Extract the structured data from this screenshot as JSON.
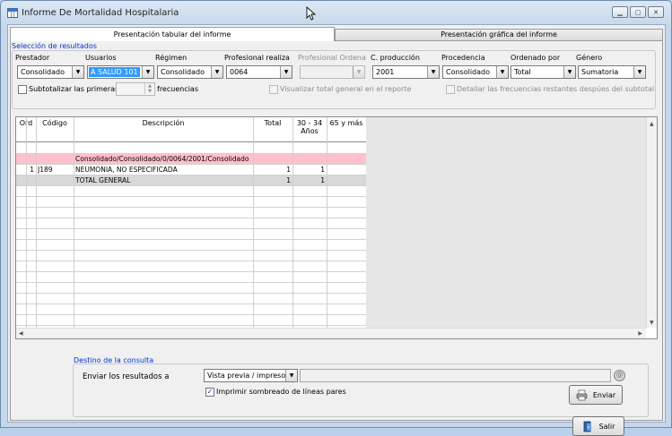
{
  "window": {
    "title": "Informe De Mortalidad Hospitalaria"
  },
  "tabs": [
    {
      "label": "Presentación tabular del informe",
      "active": true
    },
    {
      "label": "Presentación gráfica del informe",
      "active": false
    }
  ],
  "filters": {
    "section_title": "Selección de resultados",
    "fields": [
      {
        "label": "Prestador",
        "value": "Consolidado",
        "enabled": true
      },
      {
        "label": "Usuarios",
        "value": "A SALUD 101",
        "enabled": true
      },
      {
        "label": "Régimen",
        "value": "Consolidado",
        "enabled": true
      },
      {
        "label": "Profesional realiza",
        "value": "0064",
        "enabled": true
      },
      {
        "label": "Profesional Ordena",
        "value": "",
        "enabled": false
      },
      {
        "label": "C. producción",
        "value": "2001",
        "enabled": true
      },
      {
        "label": "Procedencia",
        "value": "Consolidado",
        "enabled": true
      },
      {
        "label": "Ordenado por",
        "value": "Total",
        "enabled": true
      },
      {
        "label": "Género",
        "value": "Sumatoria",
        "enabled": true
      }
    ],
    "subtotal_label": "Subtotalizar las primeras",
    "subtotal_suffix": "frecuencias",
    "visualizar_label": "Visualizar total general en el reporte",
    "detallar_label": "Detallar las frecuencias restantes despúes del subtotal"
  },
  "table": {
    "columns": [
      "Ord",
      "Código",
      "Descripción",
      "Total",
      "30 - 34 Años",
      "65 y más"
    ],
    "rows": [
      {
        "ord": "",
        "codigo": "",
        "descripcion": "",
        "total": "",
        "c30": "",
        "c65": "",
        "style": "blank"
      },
      {
        "ord": "",
        "codigo": "",
        "descripcion": "Consolidado/Consolidado/0/0064/2001/Consolidado",
        "total": "",
        "c30": "",
        "c65": "",
        "style": "pink"
      },
      {
        "ord": "1",
        "codigo": "J189",
        "descripcion": "NEUMONIA, NO ESPECIFICADA",
        "total": "1",
        "c30": "1",
        "c65": "",
        "style": "normal"
      },
      {
        "ord": "",
        "codigo": "",
        "descripcion": "TOTAL GENERAL",
        "total": "1",
        "c30": "1",
        "c65": "",
        "style": "total"
      }
    ]
  },
  "destino": {
    "section_title": "Destino de la consulta",
    "enviar_label": "Enviar los resultados a",
    "destino_value": "Vista previa / impresora",
    "path_value": "",
    "sombreado_label": "Imprimir sombreado de líneas pares",
    "sombreado_checked": true,
    "enviar_button": "Enviar"
  },
  "footer": {
    "salir_button": "Salir"
  },
  "colors": {
    "pink_row": "#ffc0cb",
    "total_row": "#d8d8d8",
    "group_title": "#0033cc",
    "selection": "#3399ff"
  }
}
